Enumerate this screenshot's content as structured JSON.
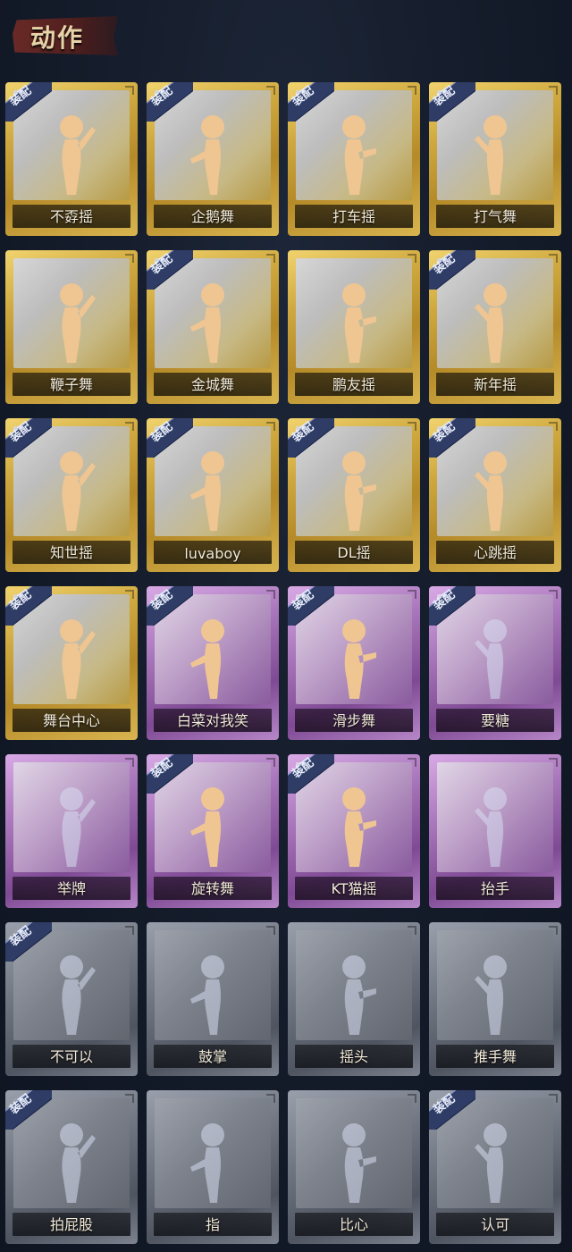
{
  "header": {
    "title": "动作"
  },
  "badge_label": "装配",
  "cards": [
    {
      "name": "不孬摇",
      "tier": "gold",
      "equipped": true,
      "owned": true
    },
    {
      "name": "企鹅舞",
      "tier": "gold",
      "equipped": true,
      "owned": true
    },
    {
      "name": "打车摇",
      "tier": "gold",
      "equipped": true,
      "owned": true
    },
    {
      "name": "打气舞",
      "tier": "gold",
      "equipped": true,
      "owned": true
    },
    {
      "name": "鞭子舞",
      "tier": "gold",
      "equipped": false,
      "owned": true
    },
    {
      "name": "金城舞",
      "tier": "gold",
      "equipped": true,
      "owned": true
    },
    {
      "name": "鹏友摇",
      "tier": "gold",
      "equipped": false,
      "owned": true
    },
    {
      "name": "新年摇",
      "tier": "gold",
      "equipped": true,
      "owned": true
    },
    {
      "name": "知世摇",
      "tier": "gold",
      "equipped": true,
      "owned": true
    },
    {
      "name": "luvaboy",
      "tier": "gold",
      "equipped": true,
      "owned": true
    },
    {
      "name": "DL摇",
      "tier": "gold",
      "equipped": true,
      "owned": true
    },
    {
      "name": "心跳摇",
      "tier": "gold",
      "equipped": true,
      "owned": true
    },
    {
      "name": "舞台中心",
      "tier": "gold",
      "equipped": true,
      "owned": true
    },
    {
      "name": "白菜对我笑",
      "tier": "purple",
      "equipped": true,
      "owned": true
    },
    {
      "name": "滑步舞",
      "tier": "purple",
      "equipped": true,
      "owned": true
    },
    {
      "name": "要糖",
      "tier": "purple",
      "equipped": true,
      "owned": false
    },
    {
      "name": "举牌",
      "tier": "purple",
      "equipped": false,
      "owned": false
    },
    {
      "name": "旋转舞",
      "tier": "purple",
      "equipped": true,
      "owned": true
    },
    {
      "name": "KT猫摇",
      "tier": "purple",
      "equipped": true,
      "owned": true
    },
    {
      "name": "抬手",
      "tier": "purple",
      "equipped": false,
      "owned": false
    },
    {
      "name": "不可以",
      "tier": "gray",
      "equipped": true,
      "owned": false
    },
    {
      "name": "鼓掌",
      "tier": "gray",
      "equipped": false,
      "owned": false
    },
    {
      "name": "摇头",
      "tier": "gray",
      "equipped": false,
      "owned": false
    },
    {
      "name": "推手舞",
      "tier": "gray",
      "equipped": false,
      "owned": false
    },
    {
      "name": "拍屁股",
      "tier": "gray",
      "equipped": true,
      "owned": false
    },
    {
      "name": "指",
      "tier": "gray",
      "equipped": false,
      "owned": false
    },
    {
      "name": "比心",
      "tier": "gray",
      "equipped": false,
      "owned": false
    },
    {
      "name": "认可",
      "tier": "gray",
      "equipped": true,
      "owned": false
    }
  ]
}
